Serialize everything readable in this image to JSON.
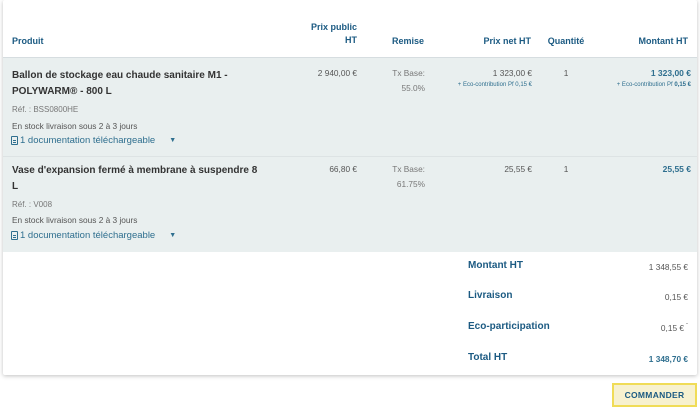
{
  "header": {
    "produit": "Produit",
    "prix_public_line1": "Prix public",
    "prix_public_line2": "HT",
    "remise": "Remise",
    "prix_net": "Prix net HT",
    "quantite": "Quantité",
    "montant": "Montant HT"
  },
  "items": [
    {
      "name_line1": "Ballon de stockage eau chaude sanitaire M1 -",
      "name_line2": "POLYWARM® - 800 L",
      "ref": "Réf. : BSS0800HE",
      "stock": "En stock livraison sous 2 à 3 jours",
      "doc": "1 documentation téléchargeable",
      "prix_public": "2 940,00 €",
      "remise_label": "Tx Base:",
      "remise_value": "55.0%",
      "prix_net": "1 323,00 €",
      "eco_label": "+ Eco-contribution Pf 0,15 €",
      "quantite": "1",
      "montant": "1 323,00 €",
      "montant_eco_label": "+ Eco-contribution Pf",
      "montant_eco_value": "0,15 €"
    },
    {
      "name_line1": "Vase d'expansion fermé à membrane à suspendre 8",
      "name_line2": "L",
      "ref": "Réf. : V008",
      "stock": "En stock livraison sous 2 à 3 jours",
      "doc": "1 documentation téléchargeable",
      "prix_public": "66,80 €",
      "remise_label": "Tx Base:",
      "remise_value": "61.75%",
      "prix_net": "25,55 €",
      "quantite": "1",
      "montant": "25,55 €"
    }
  ],
  "totals": {
    "montant_label": "Montant HT",
    "montant_value": "1 348,55 €",
    "livraison_label": "Livraison",
    "livraison_value": "0,15 €",
    "eco_label": "Eco-participation",
    "eco_value": "0,15 €",
    "total_label": "Total HT",
    "total_value": "1 348,70 €"
  },
  "actions": {
    "order_label": "COMMANDER"
  },
  "colors": {
    "accent": "#1b5a82",
    "row_bg": "#e9efef",
    "button_border": "#f0dc57"
  }
}
